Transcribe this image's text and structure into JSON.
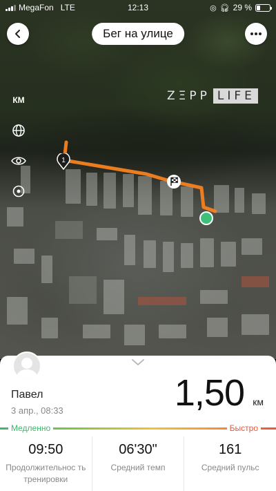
{
  "status_bar": {
    "carrier": "MegaFon",
    "network": "LTE",
    "time": "12:13",
    "battery_text": "29 %",
    "battery_level": 0.29
  },
  "header": {
    "title": "Бег на улице",
    "back_icon": "chevron-left-icon",
    "more_icon": "more-horizontal-icon"
  },
  "map": {
    "brand": {
      "prefix": "ZΞPP",
      "suffix": "LIFE"
    },
    "controls": {
      "unit_label": "КМ",
      "globe_icon": "globe-icon",
      "eye_icon": "eye-icon",
      "locate_icon": "target-icon"
    },
    "start_marker_label": "1",
    "route_color": "#f58220",
    "end_marker_color": "#3fc07a"
  },
  "summary": {
    "user_name": "Павел",
    "date": "3 апр., 08:33",
    "distance_value": "1,50",
    "distance_unit": "км"
  },
  "speed_legend": {
    "slow_label": "Медленно",
    "fast_label": "Быстро",
    "slow_color": "#3bb86a",
    "fast_color": "#e8553d"
  },
  "stats": [
    {
      "value": "09:50",
      "label": "Продолжительнос ть тренировки"
    },
    {
      "value": "06'30\"",
      "label": "Средний темп"
    },
    {
      "value": "161",
      "label": "Средний пульс"
    }
  ]
}
